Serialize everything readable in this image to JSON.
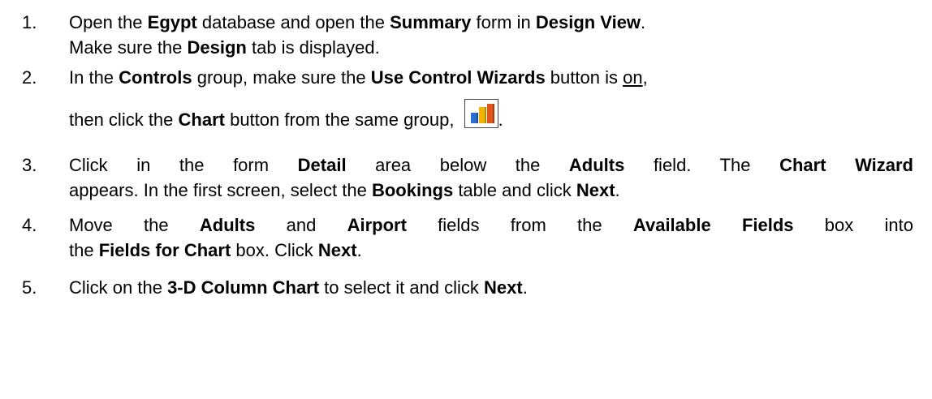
{
  "steps": [
    {
      "number": "1.",
      "segments": [
        {
          "t": "Open the ",
          "b": false
        },
        {
          "t": "Egypt",
          "b": true
        },
        {
          "t": " database and open the ",
          "b": false
        },
        {
          "t": "Summary",
          "b": true
        },
        {
          "t": " form in ",
          "b": false
        },
        {
          "t": "Design View",
          "b": true
        },
        {
          "t": ".",
          "b": false
        },
        {
          "t": "Make sure the ",
          "b": false
        },
        {
          "t": "Design",
          "b": true
        },
        {
          "t": " tab is displayed.",
          "b": false
        }
      ]
    },
    {
      "number": "2.",
      "segments": [
        {
          "t": "In the ",
          "b": false
        },
        {
          "t": "Controls",
          "b": true
        },
        {
          "t": " group, make sure the ",
          "b": false
        },
        {
          "t": "Use Control Wizards",
          "b": true
        },
        {
          "t": " button is ",
          "b": false
        },
        {
          "t": "on",
          "b": false,
          "u": true
        },
        {
          "t": ",",
          "b": false
        },
        {
          "t": "then click the ",
          "b": false
        },
        {
          "t": "Chart",
          "b": true
        },
        {
          "t": " button from the same group, ",
          "b": false
        },
        {
          "t": ".",
          "b": false
        }
      ]
    },
    {
      "number": "3.",
      "segments": [
        {
          "t": "Click in the form ",
          "b": false
        },
        {
          "t": "Detail",
          "b": true
        },
        {
          "t": " area below the ",
          "b": false
        },
        {
          "t": "Adults",
          "b": true
        },
        {
          "t": " field. The ",
          "b": false
        },
        {
          "t": "Chart Wizard",
          "b": true
        },
        {
          "t": "appears. In the first screen, select the ",
          "b": false
        },
        {
          "t": "Bookings",
          "b": true
        },
        {
          "t": " table and click ",
          "b": false
        },
        {
          "t": "Next",
          "b": true
        },
        {
          "t": ".",
          "b": false
        }
      ]
    },
    {
      "number": "4.",
      "segments": [
        {
          "t": "Move the ",
          "b": false
        },
        {
          "t": "Adults",
          "b": true
        },
        {
          "t": " and ",
          "b": false
        },
        {
          "t": "Airport",
          "b": true
        },
        {
          "t": " fields from the ",
          "b": false
        },
        {
          "t": "Available Fields",
          "b": true
        },
        {
          "t": " box into",
          "b": false
        },
        {
          "t": "the ",
          "b": false
        },
        {
          "t": "Fields for Chart",
          "b": true
        },
        {
          "t": " box. Click ",
          "b": false
        },
        {
          "t": "Next",
          "b": true
        },
        {
          "t": ".",
          "b": false
        }
      ]
    },
    {
      "number": "5.",
      "segments": [
        {
          "t": "Click on the ",
          "b": false
        },
        {
          "t": "3-D Column Chart",
          "b": true
        },
        {
          "t": " to select it and click ",
          "b": false
        },
        {
          "t": "Next",
          "b": true
        },
        {
          "t": ".",
          "b": false
        }
      ]
    }
  ],
  "icons": {
    "chart_button_icon": "chart-icon",
    "bar_colors": [
      "#2a6fd1",
      "#f0b400",
      "#e0551b"
    ]
  }
}
